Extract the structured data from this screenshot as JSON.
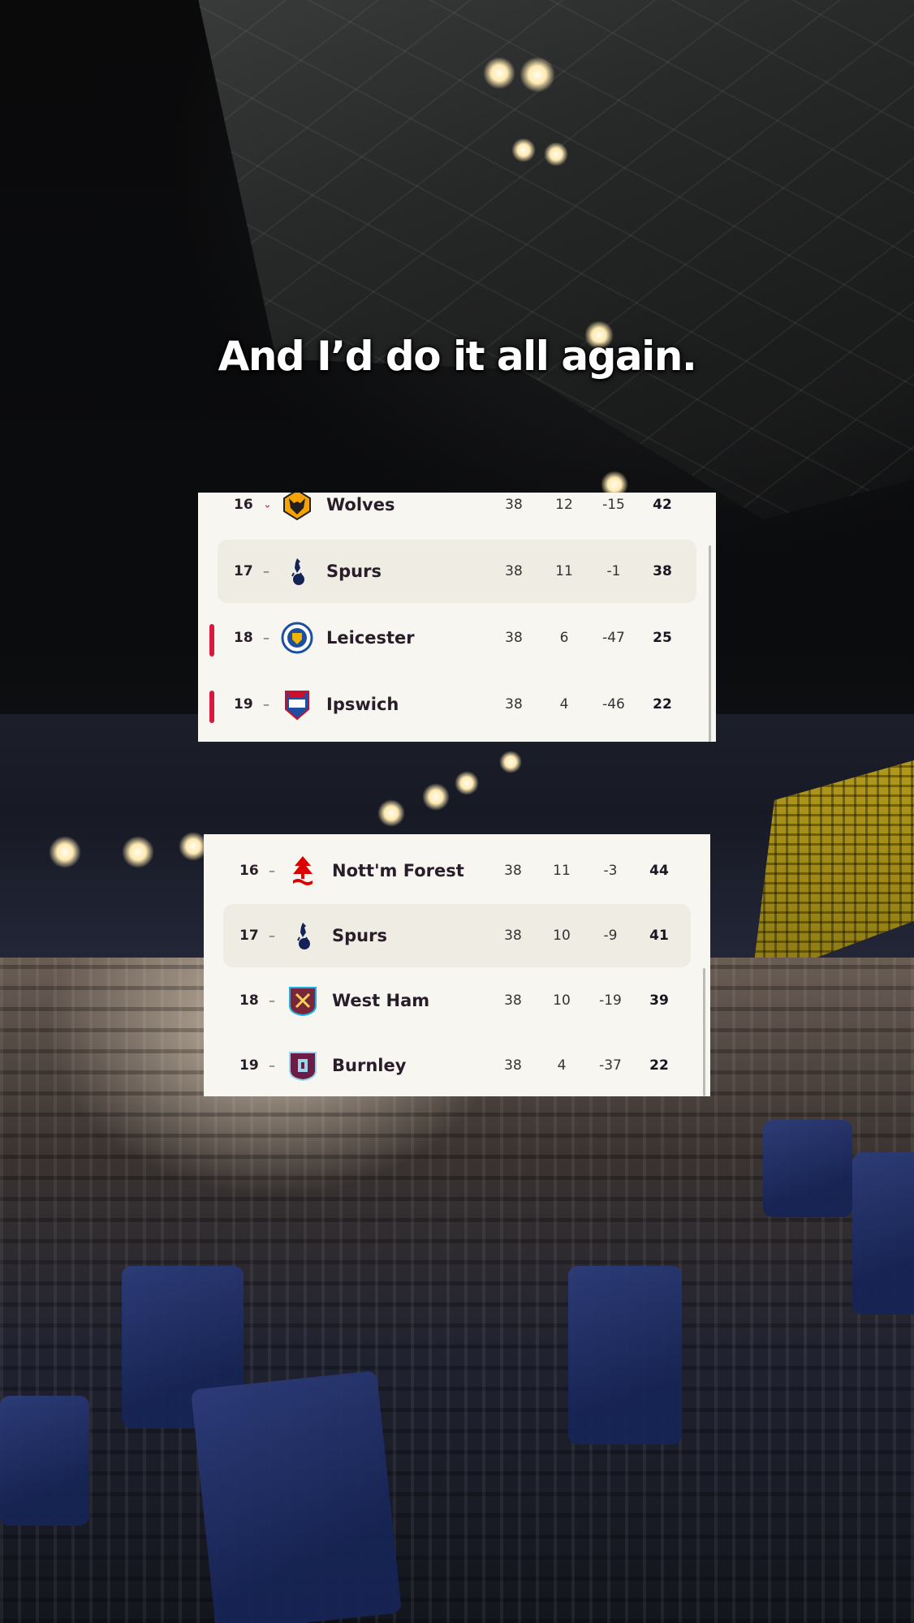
{
  "caption": "And I’d do it all again.",
  "tables": [
    {
      "rows": [
        {
          "position": "16",
          "movement": "⌄",
          "movement_type": "down",
          "team": "Wolves",
          "crest_icon": "wolves-crest-icon",
          "played": "38",
          "won": "12",
          "goal_diff": "-15",
          "points": "42",
          "highlighted": false,
          "relegation": false
        },
        {
          "position": "17",
          "movement": "–",
          "movement_type": "same",
          "team": "Spurs",
          "crest_icon": "spurs-crest-icon",
          "played": "38",
          "won": "11",
          "goal_diff": "-1",
          "points": "38",
          "highlighted": true,
          "relegation": false
        },
        {
          "position": "18",
          "movement": "–",
          "movement_type": "same",
          "team": "Leicester",
          "crest_icon": "leicester-crest-icon",
          "played": "38",
          "won": "6",
          "goal_diff": "-47",
          "points": "25",
          "highlighted": false,
          "relegation": true
        },
        {
          "position": "19",
          "movement": "–",
          "movement_type": "same",
          "team": "Ipswich",
          "crest_icon": "ipswich-crest-icon",
          "played": "38",
          "won": "4",
          "goal_diff": "-46",
          "points": "22",
          "highlighted": false,
          "relegation": true
        }
      ]
    },
    {
      "rows": [
        {
          "position": "16",
          "movement": "–",
          "movement_type": "same",
          "team": "Nott'm Forest",
          "crest_icon": "nottm-forest-crest-icon",
          "played": "38",
          "won": "11",
          "goal_diff": "-3",
          "points": "44",
          "highlighted": false,
          "relegation": false
        },
        {
          "position": "17",
          "movement": "–",
          "movement_type": "same",
          "team": "Spurs",
          "crest_icon": "spurs-crest-icon",
          "played": "38",
          "won": "10",
          "goal_diff": "-9",
          "points": "41",
          "highlighted": true,
          "relegation": false
        },
        {
          "position": "18",
          "movement": "–",
          "movement_type": "same",
          "team": "West Ham",
          "crest_icon": "west-ham-crest-icon",
          "played": "38",
          "won": "10",
          "goal_diff": "-19",
          "points": "39",
          "highlighted": false,
          "relegation": false
        },
        {
          "position": "19",
          "movement": "–",
          "movement_type": "same",
          "team": "Burnley",
          "crest_icon": "burnley-crest-icon",
          "played": "38",
          "won": "4",
          "goal_diff": "-37",
          "points": "22",
          "highlighted": false,
          "relegation": false
        }
      ]
    }
  ],
  "colors": {
    "table_bg": "#f8f6f1",
    "highlight_row": "#efece4",
    "relegation": "#d8183d",
    "text_dark": "#2a1d2a"
  }
}
